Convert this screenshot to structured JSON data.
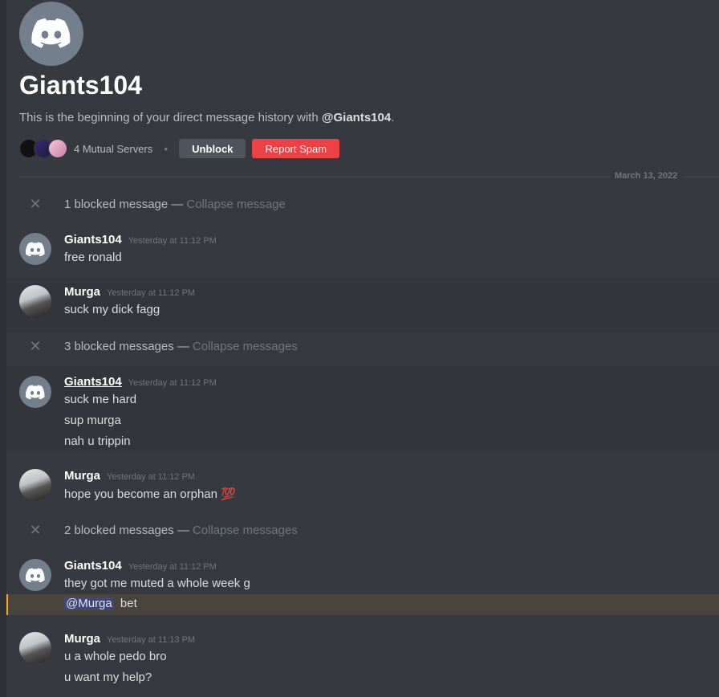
{
  "dm": {
    "title": "Giants104",
    "subtitle_prefix": "This is the beginning of your direct message history with ",
    "subtitle_handle": "@Giants104",
    "subtitle_suffix": ".",
    "mutual_servers": "4 Mutual Servers",
    "separator": "•",
    "unblock_label": "Unblock",
    "report_label": "Report Spam"
  },
  "divider": {
    "date": "March 13, 2022"
  },
  "blocked": [
    {
      "x": "✕",
      "text": "1 blocked message —",
      "link": "Collapse message"
    },
    {
      "x": "✕",
      "text": "3 blocked messages —",
      "link": "Collapse messages"
    },
    {
      "x": "✕",
      "text": "2 blocked messages —",
      "link": "Collapse messages"
    }
  ],
  "groups": [
    {
      "user": "Giants104",
      "time": "Yesterday at 11:12 PM",
      "lines": [
        "free ronald"
      ]
    },
    {
      "user": "Murga",
      "time": "Yesterday at 11:12 PM",
      "lines": [
        "suck my dick fagg"
      ]
    },
    {
      "user": "Giants104",
      "time": "Yesterday at 11:12 PM",
      "lines": [
        "suck me hard",
        "sup murga",
        "nah u trippin"
      ]
    },
    {
      "user": "Murga",
      "time": "Yesterday at 11:12 PM",
      "lines": [
        "hope you become an orphan 💯"
      ]
    },
    {
      "user": "Giants104",
      "time": "Yesterday at 11:12 PM",
      "lines": [
        "they got me muted a whole week g"
      ]
    },
    {
      "user": "Murga",
      "time": "Yesterday at 11:13 PM",
      "lines": [
        "u a whole pedo bro",
        "u want my help?"
      ]
    }
  ],
  "mention_message": {
    "mention": "@Murga",
    "text": "bet"
  },
  "colors": {
    "accent_red": "#ed4245",
    "mention_bar": "#faa81a"
  }
}
